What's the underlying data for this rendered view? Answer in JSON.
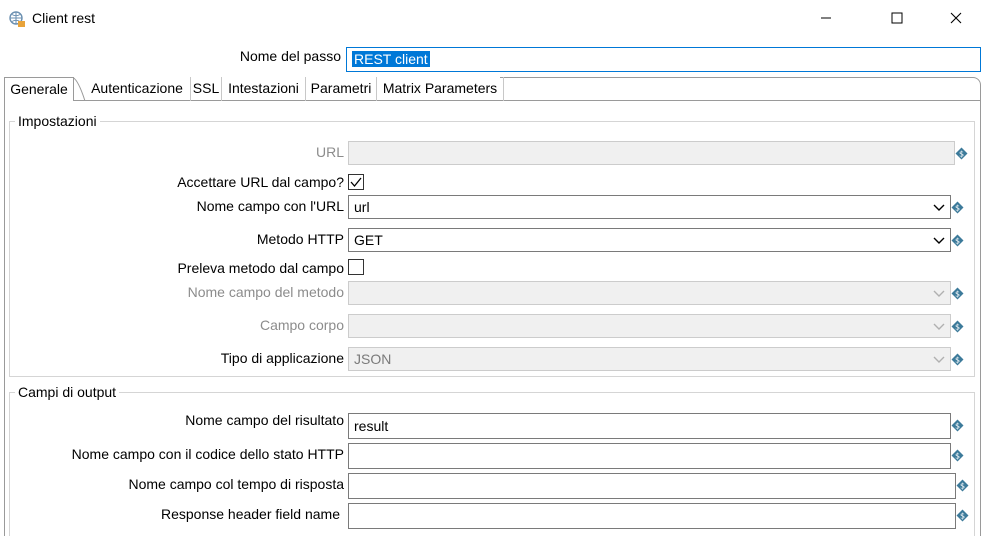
{
  "window": {
    "title": "Client rest"
  },
  "step": {
    "label": "Nome del passo",
    "value": "REST client"
  },
  "tabs": [
    {
      "label": "Generale",
      "active": true
    },
    {
      "label": "Autenticazione",
      "active": false
    },
    {
      "label": "SSL",
      "active": false
    },
    {
      "label": "Intestazioni",
      "active": false
    },
    {
      "label": "Parametri",
      "active": false
    },
    {
      "label": "Matrix Parameters",
      "active": false
    }
  ],
  "settings": {
    "title": "Impostazioni",
    "url_label": "URL",
    "url_value": "",
    "accept_url_label": "Accettare URL dal campo?",
    "accept_url_checked": true,
    "url_field_label": "Nome campo con l'URL",
    "url_field_value": "url",
    "method_label": "Metodo HTTP",
    "method_value": "GET",
    "method_from_field_label": "Preleva metodo dal campo",
    "method_from_field_checked": false,
    "method_field_label": "Nome campo del metodo",
    "method_field_value": "",
    "body_field_label": "Campo corpo",
    "body_field_value": "",
    "app_type_label": "Tipo di applicazione",
    "app_type_value": "JSON"
  },
  "output": {
    "title": "Campi di output",
    "result_label": "Nome campo del risultato",
    "result_value": "result",
    "status_label": "Nome campo con il codice dello stato HTTP",
    "status_value": "",
    "response_time_label": "Nome campo col tempo di risposta",
    "response_time_value": "",
    "response_header_label": "Response header field name",
    "response_header_value": ""
  },
  "colors": {
    "accent": "#0078d7",
    "variable_icon": "#3c7a9a"
  }
}
